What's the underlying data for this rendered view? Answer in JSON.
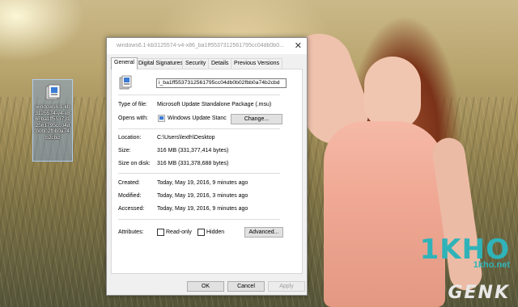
{
  "desktop": {
    "icon_label": "windows6.1-kb3125574-v4-x86_ba1ff5537312561795cc04db0b02fbb0a74b2cbd"
  },
  "watermark": {
    "logo": "1KHO",
    "url": "1kho.net",
    "brand": "GENK"
  },
  "dialog": {
    "title": "windows6.1-kb3125574-v4-x86_ba1ff5537312561795cc04db0b0...",
    "tabs": [
      "General",
      "Digital Signatures",
      "Security",
      "Details",
      "Previous Versions"
    ],
    "active_tab": "General",
    "file_name": "i_ba1ff5537312561795cc04db0b02fbb0a74b2cbd",
    "fields": {
      "type_of_file_label": "Type of file:",
      "type_of_file": "Microsoft Update Standalone Package (.msu)",
      "opens_with_label": "Opens with:",
      "opens_with": "Windows Update Stanc",
      "change_button": "Change...",
      "location_label": "Location:",
      "location": "C:\\Users\\lexth\\Desktop",
      "size_label": "Size:",
      "size": "316 MB (331,377,414 bytes)",
      "size_on_disk_label": "Size on disk:",
      "size_on_disk": "316 MB (331,378,688 bytes)",
      "created_label": "Created:",
      "created": "Today, May 19, 2016, 9 minutes ago",
      "modified_label": "Modified:",
      "modified": "Today, May 19, 2016, 3 minutes ago",
      "accessed_label": "Accessed:",
      "accessed": "Today, May 19, 2016, 9 minutes ago",
      "attributes_label": "Attributes:",
      "readonly_label": "Read-only",
      "hidden_label": "Hidden",
      "advanced_button": "Advanced..."
    },
    "buttons": {
      "ok": "OK",
      "cancel": "Cancel",
      "apply": "Apply"
    }
  }
}
